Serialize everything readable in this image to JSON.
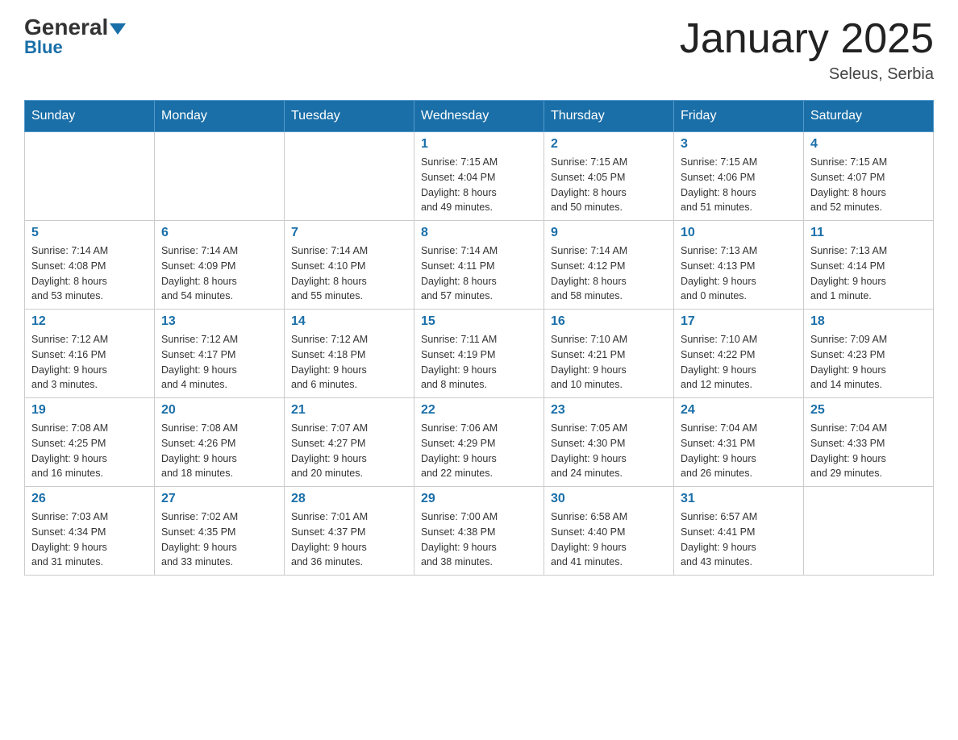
{
  "logo": {
    "general": "General",
    "blue": "Blue"
  },
  "header": {
    "title": "January 2025",
    "location": "Seleus, Serbia"
  },
  "weekdays": [
    "Sunday",
    "Monday",
    "Tuesday",
    "Wednesday",
    "Thursday",
    "Friday",
    "Saturday"
  ],
  "weeks": [
    [
      {
        "day": "",
        "info": ""
      },
      {
        "day": "",
        "info": ""
      },
      {
        "day": "",
        "info": ""
      },
      {
        "day": "1",
        "info": "Sunrise: 7:15 AM\nSunset: 4:04 PM\nDaylight: 8 hours\nand 49 minutes."
      },
      {
        "day": "2",
        "info": "Sunrise: 7:15 AM\nSunset: 4:05 PM\nDaylight: 8 hours\nand 50 minutes."
      },
      {
        "day": "3",
        "info": "Sunrise: 7:15 AM\nSunset: 4:06 PM\nDaylight: 8 hours\nand 51 minutes."
      },
      {
        "day": "4",
        "info": "Sunrise: 7:15 AM\nSunset: 4:07 PM\nDaylight: 8 hours\nand 52 minutes."
      }
    ],
    [
      {
        "day": "5",
        "info": "Sunrise: 7:14 AM\nSunset: 4:08 PM\nDaylight: 8 hours\nand 53 minutes."
      },
      {
        "day": "6",
        "info": "Sunrise: 7:14 AM\nSunset: 4:09 PM\nDaylight: 8 hours\nand 54 minutes."
      },
      {
        "day": "7",
        "info": "Sunrise: 7:14 AM\nSunset: 4:10 PM\nDaylight: 8 hours\nand 55 minutes."
      },
      {
        "day": "8",
        "info": "Sunrise: 7:14 AM\nSunset: 4:11 PM\nDaylight: 8 hours\nand 57 minutes."
      },
      {
        "day": "9",
        "info": "Sunrise: 7:14 AM\nSunset: 4:12 PM\nDaylight: 8 hours\nand 58 minutes."
      },
      {
        "day": "10",
        "info": "Sunrise: 7:13 AM\nSunset: 4:13 PM\nDaylight: 9 hours\nand 0 minutes."
      },
      {
        "day": "11",
        "info": "Sunrise: 7:13 AM\nSunset: 4:14 PM\nDaylight: 9 hours\nand 1 minute."
      }
    ],
    [
      {
        "day": "12",
        "info": "Sunrise: 7:12 AM\nSunset: 4:16 PM\nDaylight: 9 hours\nand 3 minutes."
      },
      {
        "day": "13",
        "info": "Sunrise: 7:12 AM\nSunset: 4:17 PM\nDaylight: 9 hours\nand 4 minutes."
      },
      {
        "day": "14",
        "info": "Sunrise: 7:12 AM\nSunset: 4:18 PM\nDaylight: 9 hours\nand 6 minutes."
      },
      {
        "day": "15",
        "info": "Sunrise: 7:11 AM\nSunset: 4:19 PM\nDaylight: 9 hours\nand 8 minutes."
      },
      {
        "day": "16",
        "info": "Sunrise: 7:10 AM\nSunset: 4:21 PM\nDaylight: 9 hours\nand 10 minutes."
      },
      {
        "day": "17",
        "info": "Sunrise: 7:10 AM\nSunset: 4:22 PM\nDaylight: 9 hours\nand 12 minutes."
      },
      {
        "day": "18",
        "info": "Sunrise: 7:09 AM\nSunset: 4:23 PM\nDaylight: 9 hours\nand 14 minutes."
      }
    ],
    [
      {
        "day": "19",
        "info": "Sunrise: 7:08 AM\nSunset: 4:25 PM\nDaylight: 9 hours\nand 16 minutes."
      },
      {
        "day": "20",
        "info": "Sunrise: 7:08 AM\nSunset: 4:26 PM\nDaylight: 9 hours\nand 18 minutes."
      },
      {
        "day": "21",
        "info": "Sunrise: 7:07 AM\nSunset: 4:27 PM\nDaylight: 9 hours\nand 20 minutes."
      },
      {
        "day": "22",
        "info": "Sunrise: 7:06 AM\nSunset: 4:29 PM\nDaylight: 9 hours\nand 22 minutes."
      },
      {
        "day": "23",
        "info": "Sunrise: 7:05 AM\nSunset: 4:30 PM\nDaylight: 9 hours\nand 24 minutes."
      },
      {
        "day": "24",
        "info": "Sunrise: 7:04 AM\nSunset: 4:31 PM\nDaylight: 9 hours\nand 26 minutes."
      },
      {
        "day": "25",
        "info": "Sunrise: 7:04 AM\nSunset: 4:33 PM\nDaylight: 9 hours\nand 29 minutes."
      }
    ],
    [
      {
        "day": "26",
        "info": "Sunrise: 7:03 AM\nSunset: 4:34 PM\nDaylight: 9 hours\nand 31 minutes."
      },
      {
        "day": "27",
        "info": "Sunrise: 7:02 AM\nSunset: 4:35 PM\nDaylight: 9 hours\nand 33 minutes."
      },
      {
        "day": "28",
        "info": "Sunrise: 7:01 AM\nSunset: 4:37 PM\nDaylight: 9 hours\nand 36 minutes."
      },
      {
        "day": "29",
        "info": "Sunrise: 7:00 AM\nSunset: 4:38 PM\nDaylight: 9 hours\nand 38 minutes."
      },
      {
        "day": "30",
        "info": "Sunrise: 6:58 AM\nSunset: 4:40 PM\nDaylight: 9 hours\nand 41 minutes."
      },
      {
        "day": "31",
        "info": "Sunrise: 6:57 AM\nSunset: 4:41 PM\nDaylight: 9 hours\nand 43 minutes."
      },
      {
        "day": "",
        "info": ""
      }
    ]
  ]
}
